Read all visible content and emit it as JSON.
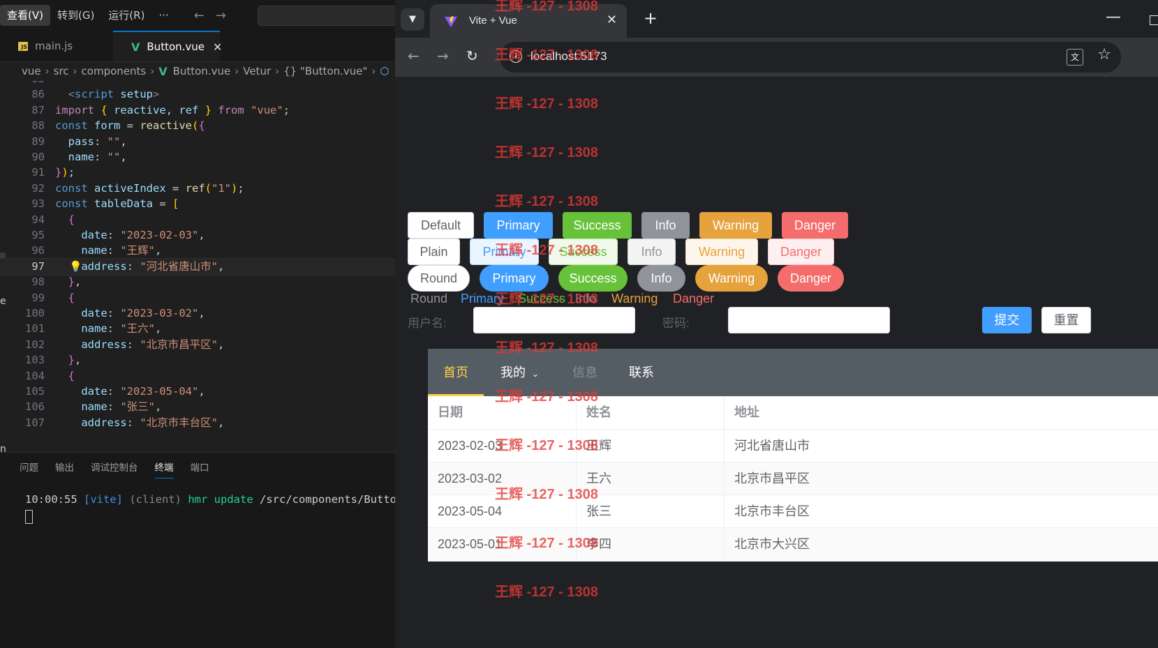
{
  "vscode": {
    "menu": [
      "查看(V)",
      "转到(G)",
      "运行(R)",
      "···"
    ],
    "tabs": [
      {
        "label": "main.js",
        "icon": "js-file-icon"
      },
      {
        "label": "Button.vue",
        "icon": "vue-file-icon"
      }
    ],
    "breadcrumb": [
      "vue",
      "src",
      "components",
      "Button.vue",
      "Vetur",
      "{} \"Button.vue\""
    ],
    "current_line": 97,
    "lines": [
      {
        "n": 85,
        "html": ""
      },
      {
        "n": 86,
        "html": "  <span class='tg'>&lt;</span><span class='tn'>script</span> <span class='v'>setup</span><span class='tg'>&gt;</span>"
      },
      {
        "n": 87,
        "html": "<span class='kc'>import</span> <span class='p'>{</span> <span class='v'>reactive</span>, <span class='v'>ref</span> <span class='p'>}</span> <span class='kc'>from</span> <span class='s'>\"vue\"</span>;"
      },
      {
        "n": 88,
        "html": "<span class='k'>const</span> <span class='v'>form</span> = <span class='f'>reactive</span><span class='p'>(</span><span class='p2'>{</span>"
      },
      {
        "n": 89,
        "html": "  <span class='v'>pass</span>: <span class='s'>\"\"</span>,"
      },
      {
        "n": 90,
        "html": "  <span class='v'>name</span>: <span class='s'>\"\"</span>,"
      },
      {
        "n": 91,
        "html": "<span class='p2'>}</span><span class='p'>)</span>;"
      },
      {
        "n": 92,
        "html": "<span class='k'>const</span> <span class='v'>activeIndex</span> = <span class='f'>ref</span><span class='p'>(</span><span class='s'>\"1\"</span><span class='p'>)</span>;"
      },
      {
        "n": 93,
        "html": "<span class='k'>const</span> <span class='v'>tableData</span> = <span class='p'>[</span>"
      },
      {
        "n": 94,
        "html": "  <span class='p2'>{</span>"
      },
      {
        "n": 95,
        "html": "    <span class='v'>date</span>: <span class='s'>\"2023-02-03\"</span>,"
      },
      {
        "n": 96,
        "html": "    <span class='v'>name</span>: <span class='s'>\"王辉\"</span>,"
      },
      {
        "n": 97,
        "html": "    <span class='v'>address</span>: <span class='s'>\"河北省唐山市\"</span>,"
      },
      {
        "n": 98,
        "html": "  <span class='p2'>}</span>,"
      },
      {
        "n": 99,
        "html": "  <span class='p2'>{</span>"
      },
      {
        "n": 100,
        "html": "    <span class='v'>date</span>: <span class='s'>\"2023-03-02\"</span>,"
      },
      {
        "n": 101,
        "html": "    <span class='v'>name</span>: <span class='s'>\"王六\"</span>,"
      },
      {
        "n": 102,
        "html": "    <span class='v'>address</span>: <span class='s'>\"北京市昌平区\"</span>,"
      },
      {
        "n": 103,
        "html": "  <span class='p2'>}</span>,"
      },
      {
        "n": 104,
        "html": "  <span class='p2'>{</span>"
      },
      {
        "n": 105,
        "html": "    <span class='v'>date</span>: <span class='s'>\"2023-05-04\"</span>,"
      },
      {
        "n": 106,
        "html": "    <span class='v'>name</span>: <span class='s'>\"张三\"</span>,"
      },
      {
        "n": 107,
        "html": "    <span class='v'>address</span>: <span class='s'>\"北京市丰台区\"</span>,"
      }
    ],
    "panel_tabs": [
      "问题",
      "输出",
      "调试控制台",
      "终端",
      "端口"
    ],
    "active_panel_tab": "终端",
    "terminal": {
      "time": "10:00:55",
      "tag": "[vite]",
      "client": "(client)",
      "hmr": "hmr update",
      "path": "/src/components/Button."
    },
    "sidebar_chars": [
      "e",
      "n"
    ]
  },
  "browser": {
    "tab_title": "Vite + Vue",
    "url": "localhost:5173",
    "buttons": {
      "row1": [
        "Default",
        "Primary",
        "Success",
        "Info",
        "Warning",
        "Danger"
      ],
      "row2": [
        "Plain",
        "Primary",
        "Success",
        "Info",
        "Warning",
        "Danger"
      ],
      "row3": [
        "Round",
        "Primary",
        "Success",
        "Info",
        "Warning",
        "Danger"
      ],
      "row4": [
        "Round",
        "Primary",
        "Success",
        "Info",
        "Warning",
        "Danger"
      ]
    },
    "form": {
      "username_label": "用户名:",
      "password_label": "密码:",
      "submit": "提交",
      "reset": "重置"
    },
    "menu": {
      "items": [
        "首页",
        "我的",
        "信息",
        "联系"
      ],
      "active": "首页",
      "disabled": "信息"
    },
    "table": {
      "headers": [
        "日期",
        "姓名",
        "地址"
      ],
      "rows": [
        [
          "2023-02-03",
          "王辉",
          "河北省唐山市"
        ],
        [
          "2023-03-02",
          "王六",
          "北京市昌平区"
        ],
        [
          "2023-05-04",
          "张三",
          "北京市丰台区"
        ],
        [
          "2023-05-01",
          "李四",
          "北京市大兴区"
        ]
      ]
    },
    "watermark": "王辉 -127 - 1308"
  },
  "colors": {
    "primary": "#409eff",
    "success": "#67c23a",
    "info": "#909399",
    "warning": "#e6a23c",
    "danger": "#f56c6c",
    "menu_bg": "#545c64",
    "menu_active": "#ffd04b"
  }
}
